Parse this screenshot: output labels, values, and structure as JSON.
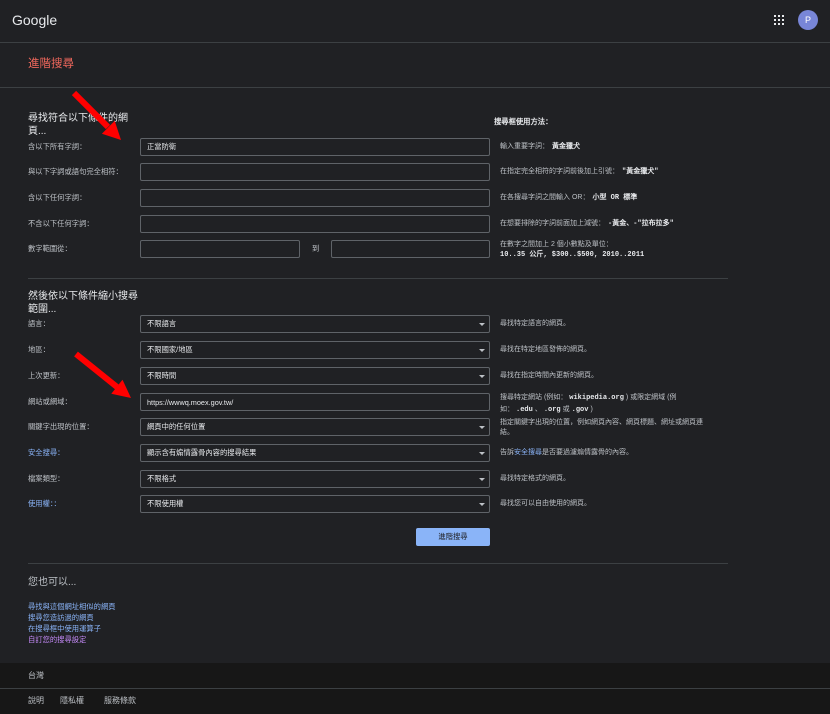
{
  "header": {
    "logo": "Google",
    "avatar_letter": "P"
  },
  "icons": {
    "apps": "apps-grid-icon",
    "dropdown": "chevron-down-icon",
    "annotation": "red-arrow-icon"
  },
  "colors": {
    "background": "#202124",
    "footer_background": "#171717",
    "page_title": "#ee675c",
    "link": "#8ab4f8",
    "visited_link": "#c58af9",
    "button": "#8ab4f8",
    "avatar": "#7886d7",
    "annotation_arrow": "#ff0000"
  },
  "page_title": "進階搜尋",
  "find_section": {
    "heading": "尋找符合以下條件的網頁...",
    "help_heading": "搜尋框使用方法：",
    "rows": [
      {
        "label": "含以下所有字詞：",
        "value": "正當防衛",
        "hint": "輸入重要字詞：",
        "example": "黃金獵犬"
      },
      {
        "label": "與以下字詞或語句完全相符：",
        "hint": "在指定完全相符的字詞前後加上引號：",
        "example": "\"黃金獵犬\""
      },
      {
        "label": "含以下任何字詞：",
        "hint": "在各搜尋字詞之間輸入 OR：",
        "example": "小型 OR 標準"
      },
      {
        "label": "不含以下任何字詞：",
        "hint": "在想要排除的字詞前面加上減號：",
        "example": "-黃金、-\"拉布拉多\""
      }
    ],
    "number_range": {
      "label": "數字範圍從：",
      "to_label": "到",
      "hint": "在數字之間加上 2 個小數點及單位：",
      "example": "10..35 公斤, $300..$500, 2010..2011"
    }
  },
  "narrow_section": {
    "heading": "然後依以下條件縮小搜尋範圍...",
    "language": {
      "label": "語言：",
      "value": "不限語言",
      "hint": "尋找特定語言的網頁。"
    },
    "region": {
      "label": "地區：",
      "value": "不限國家/地區",
      "hint": "尋找在特定地區發佈的網頁。"
    },
    "last_update": {
      "label": "上次更新：",
      "value": "不限時間",
      "hint": "尋找在指定時間內更新的網頁。"
    },
    "site": {
      "label": "網站或網域：",
      "value": "https://wwwq.moex.gov.tw/",
      "hint_line1": {
        "text_a": "搜尋特定網站 (例如：",
        "code": "wikipedia.org",
        "text_b": ") 或限定網域 (例"
      },
      "hint_line2": {
        "text_a": "如：",
        "code_a": ".edu",
        "text_b": "、",
        "code_b": ".org",
        "text_c": "或",
        "code_c": ".gov",
        "text_d": ")"
      }
    },
    "terms_location": {
      "label": "關鍵字出現的位置：",
      "value": "網頁中的任何位置",
      "hint_lines": [
        "指定關鍵字出現的位置，例如網頁內容、網頁標題、網址或網頁連",
        "結。"
      ]
    },
    "safesearch": {
      "label": "安全搜尋：",
      "value": "顯示含有煽情露骨內容的搜尋結果",
      "hint_before": "告訴",
      "hint_link": "安全搜尋",
      "hint_after": "是否要過濾煽情露骨的內容。"
    },
    "file_type": {
      "label": "檔案類型：",
      "value": "不限格式",
      "hint": "尋找特定格式的網頁。"
    },
    "usage_rights": {
      "label": "使用權：：",
      "value": "不限使用權",
      "hint": "尋找您可以自由使用的網頁。"
    }
  },
  "submit_label": "進階搜尋",
  "also_section": {
    "heading": "您也可以...",
    "links": [
      "尋找與這個網址相似的網頁",
      "搜尋您造訪過的網頁",
      "在搜尋框中使用運算子",
      "自訂您的搜尋設定"
    ]
  },
  "footer": {
    "country": "台灣",
    "links": [
      "說明",
      "隱私權",
      "服務條款"
    ]
  }
}
